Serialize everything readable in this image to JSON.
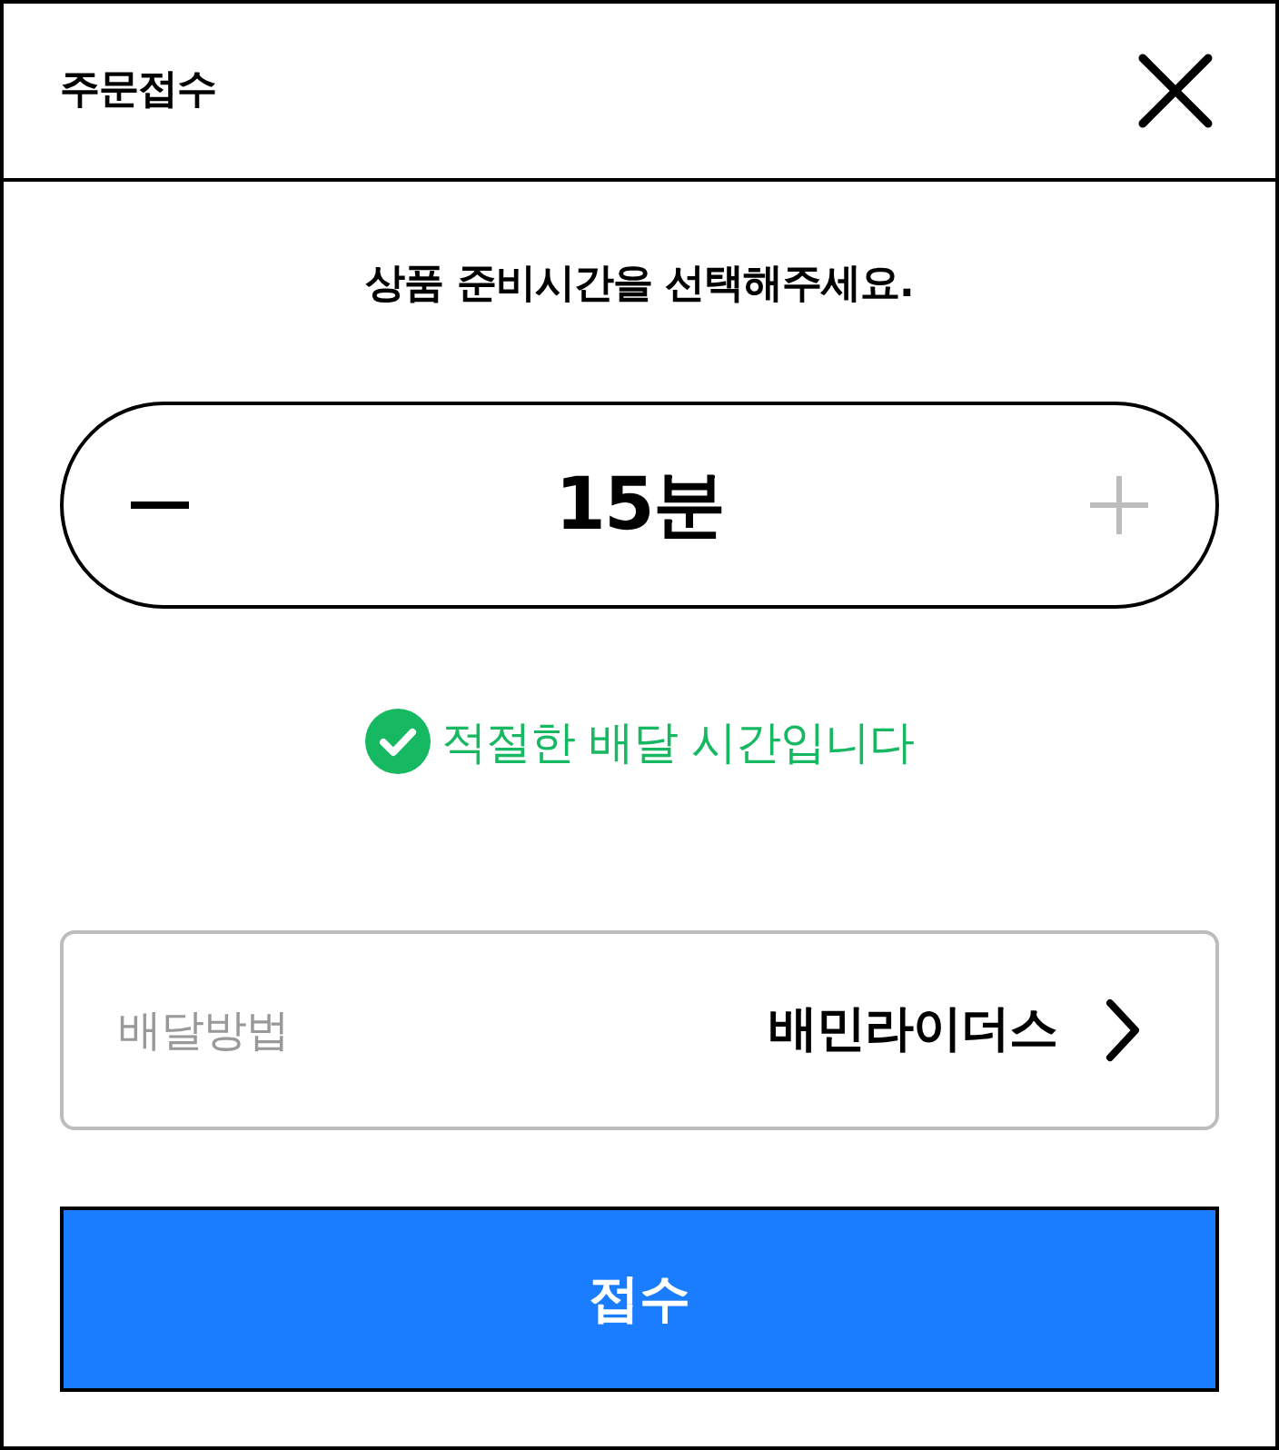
{
  "window": {
    "title": "주문접수"
  },
  "prompt": "상품 준비시간을 선택해주세요.",
  "stepper": {
    "value": "15분",
    "decrease_disabled": false,
    "increase_disabled": true
  },
  "status": {
    "kind": "success",
    "message": "적절한 배달 시간입니다"
  },
  "delivery": {
    "label": "배달방법",
    "value": "배민라이더스"
  },
  "submit_button": {
    "label": "접수"
  }
}
